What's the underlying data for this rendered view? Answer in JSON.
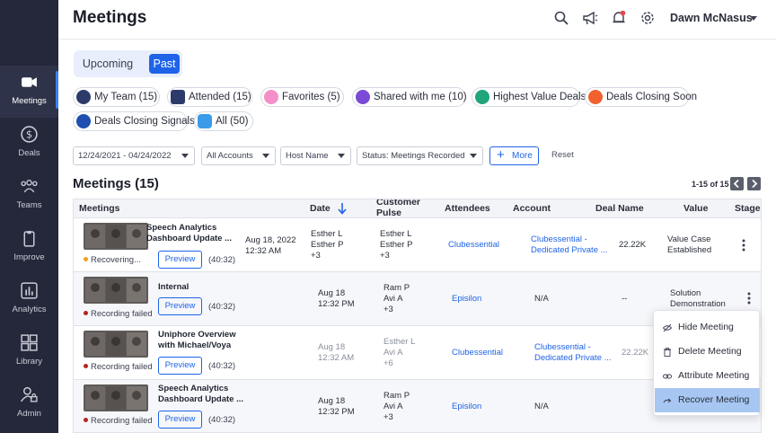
{
  "sidebar": {
    "items": [
      {
        "label": "Meetings",
        "icon": "video-camera-icon",
        "active": true
      },
      {
        "label": "Deals",
        "icon": "dollar-icon"
      },
      {
        "label": "Teams",
        "icon": "team-icon"
      },
      {
        "label": "Improve",
        "icon": "clipboard-icon"
      },
      {
        "label": "Analytics",
        "icon": "bar-chart-icon"
      },
      {
        "label": "Library",
        "icon": "grid-icon"
      },
      {
        "label": "Admin",
        "icon": "admin-icon"
      }
    ]
  },
  "header": {
    "title": "Meetings",
    "user_name": "Dawn McNasus"
  },
  "tabs": {
    "upcoming": "Upcoming",
    "past": "Past"
  },
  "chips": [
    {
      "label": "My Team (15)",
      "color": "#2d3b6b"
    },
    {
      "label": "Attended (15)",
      "color": "#2d3b6b"
    },
    {
      "label": "Favorites (5)",
      "color": "#f48fc9"
    },
    {
      "label": "Shared with me (10)",
      "color": "#7b4bd6"
    },
    {
      "label": "Highest Value Deals",
      "color": "#1fa67a"
    },
    {
      "label": "Deals Closing Soon",
      "color": "#f0612e"
    },
    {
      "label": "Deals Closing Signals",
      "color": "#1f4fb0"
    },
    {
      "label": "All (50)",
      "color": "#3a9be8"
    }
  ],
  "filters": {
    "date_range": "12/24/2021 - 04/24/2022",
    "accounts": "All Accounts",
    "host": "Host Name",
    "status": "Status: Meetings Recorded",
    "more": "More",
    "reset": "Reset"
  },
  "section": {
    "title": "Meetings (15)",
    "pager": "1-15 of 15"
  },
  "table": {
    "columns": [
      "Meetings",
      "Date",
      "Customer Pulse",
      "Attendees",
      "Account",
      "Deal Name",
      "Value",
      "Stage"
    ],
    "preview_label": "Preview",
    "rows": [
      {
        "title_1": "Speech Analytics",
        "title_2": "Dashboard Update ...",
        "status": "Recovering...",
        "status_color": "#f0a020",
        "duration": "(40:32)",
        "date_1": "Aug 18, 2022",
        "date_2": "12:32 AM",
        "pulse": [
          "Esther L",
          "Esther P",
          "+3"
        ],
        "attendees": [
          "Esther L",
          "Esther P",
          "+3"
        ],
        "account": "Clubessential",
        "deal": [
          "Clubessential -",
          "Dedicated Private ..."
        ],
        "value": "22.22K",
        "stage": [
          "Value Case",
          "Established"
        ]
      },
      {
        "title_1": "Internal",
        "title_2": "",
        "status": "Recording failed",
        "status_color": "#b3261e",
        "duration": "(40:32)",
        "date_1": "Aug 18",
        "date_2": "12:32 PM",
        "attendees": [
          "Ram P",
          "Avi A",
          "+3"
        ],
        "account": "Episilon",
        "deal": [
          "N/A"
        ],
        "value": "--",
        "stage": [
          "Solution",
          "Demonstration"
        ]
      },
      {
        "title_1": "Uniphore Overview",
        "title_2": "with Michael/Voya",
        "status": "Recording failed",
        "status_color": "#b3261e",
        "duration": "(40:32)",
        "date_1": "Aug 18",
        "date_2": "12:32 AM",
        "attendees": [
          "Esther L",
          "Avi A",
          "+6"
        ],
        "account": "Clubessential",
        "deal": [
          "Clubessential -",
          "Dedicated Private ..."
        ],
        "value": "22.22K"
      },
      {
        "title_1": "Speech Analytics",
        "title_2": "Dashboard Update ...",
        "status": "Recording failed",
        "status_color": "#b3261e",
        "duration": "(40:32)",
        "date_1": "Aug 18",
        "date_2": "12:32 PM",
        "attendees": [
          "Ram P",
          "Avi A",
          "+3"
        ],
        "account": "Episilon",
        "deal": [
          "N/A"
        ],
        "value": "--"
      }
    ]
  },
  "context_menu": {
    "items": [
      {
        "label": "Hide Meeting",
        "icon": "eye-off-icon"
      },
      {
        "label": "Delete Meeting",
        "icon": "trash-icon"
      },
      {
        "label": "Attribute Meeting",
        "icon": "link-icon"
      },
      {
        "label": "Recover Meeting",
        "icon": "redo-icon",
        "highlighted": true
      }
    ]
  },
  "colors": {
    "accent": "#1f64e8",
    "sidebar": "#24283a",
    "failed": "#b3261e",
    "recovering": "#f0a020",
    "menu_highlight": "#a7c7f2"
  }
}
